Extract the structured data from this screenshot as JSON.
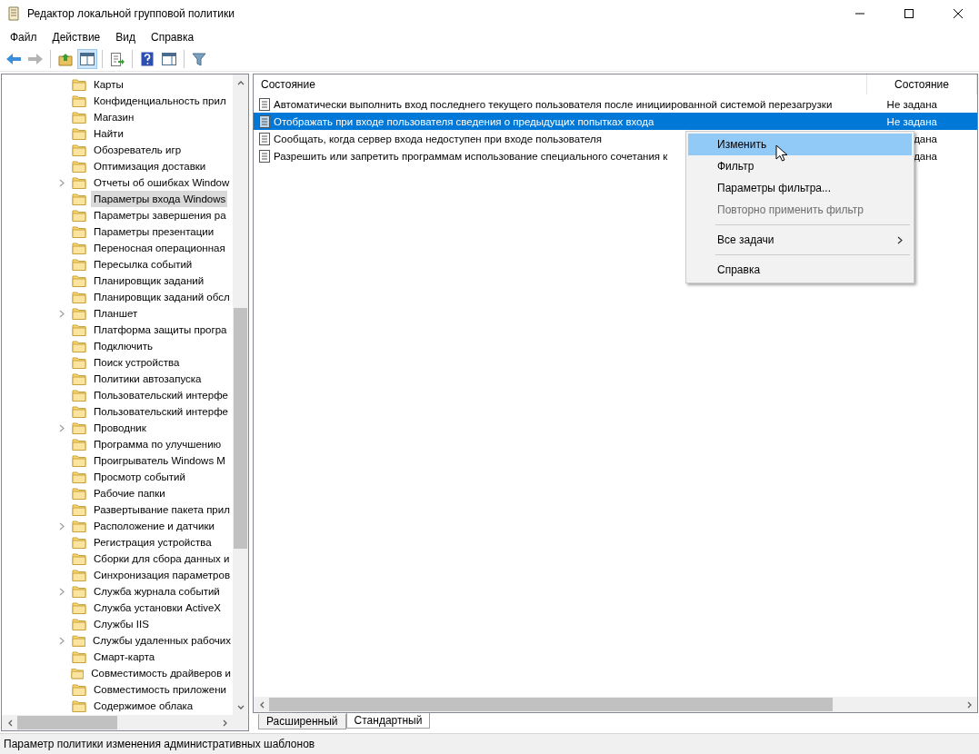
{
  "window": {
    "title": "Редактор локальной групповой политики"
  },
  "menu_bar": [
    "Файл",
    "Действие",
    "Вид",
    "Справка"
  ],
  "toolbar": [
    {
      "kind": "back",
      "pressed": false,
      "disabled": false
    },
    {
      "kind": "forward",
      "pressed": false,
      "disabled": true
    },
    {
      "kind": "sep"
    },
    {
      "kind": "up",
      "pressed": false,
      "disabled": false
    },
    {
      "kind": "tree",
      "pressed": true,
      "disabled": false
    },
    {
      "kind": "sep"
    },
    {
      "kind": "export",
      "pressed": false,
      "disabled": false
    },
    {
      "kind": "sep"
    },
    {
      "kind": "help",
      "pressed": false,
      "disabled": false
    },
    {
      "kind": "pane",
      "pressed": false,
      "disabled": false
    },
    {
      "kind": "sep"
    },
    {
      "kind": "filter",
      "pressed": false,
      "disabled": false
    }
  ],
  "tree": [
    {
      "label": "Карты",
      "expandable": false,
      "selected": false
    },
    {
      "label": "Конфиденциальность прил",
      "expandable": false,
      "selected": false
    },
    {
      "label": "Магазин",
      "expandable": false,
      "selected": false
    },
    {
      "label": "Найти",
      "expandable": false,
      "selected": false
    },
    {
      "label": "Обозреватель игр",
      "expandable": false,
      "selected": false
    },
    {
      "label": "Оптимизация доставки",
      "expandable": false,
      "selected": false
    },
    {
      "label": "Отчеты об ошибках Window",
      "expandable": true,
      "selected": false
    },
    {
      "label": "Параметры входа Windows",
      "expandable": false,
      "selected": true
    },
    {
      "label": "Параметры завершения ра",
      "expandable": false,
      "selected": false
    },
    {
      "label": "Параметры презентации",
      "expandable": false,
      "selected": false
    },
    {
      "label": "Переносная операционная",
      "expandable": false,
      "selected": false
    },
    {
      "label": "Пересылка событий",
      "expandable": false,
      "selected": false
    },
    {
      "label": "Планировщик заданий",
      "expandable": false,
      "selected": false
    },
    {
      "label": "Планировщик заданий обсл",
      "expandable": false,
      "selected": false
    },
    {
      "label": "Планшет",
      "expandable": true,
      "selected": false
    },
    {
      "label": "Платформа защиты програ",
      "expandable": false,
      "selected": false
    },
    {
      "label": "Подключить",
      "expandable": false,
      "selected": false
    },
    {
      "label": "Поиск устройства",
      "expandable": false,
      "selected": false
    },
    {
      "label": "Политики автозапуска",
      "expandable": false,
      "selected": false
    },
    {
      "label": "Пользовательский интерфе",
      "expandable": false,
      "selected": false
    },
    {
      "label": "Пользовательский интерфе",
      "expandable": false,
      "selected": false
    },
    {
      "label": "Проводник",
      "expandable": true,
      "selected": false
    },
    {
      "label": "Программа по улучшению",
      "expandable": false,
      "selected": false
    },
    {
      "label": "Проигрыватель Windows M",
      "expandable": false,
      "selected": false
    },
    {
      "label": "Просмотр событий",
      "expandable": false,
      "selected": false
    },
    {
      "label": "Рабочие папки",
      "expandable": false,
      "selected": false
    },
    {
      "label": "Развертывание пакета прил",
      "expandable": false,
      "selected": false
    },
    {
      "label": "Расположение и датчики",
      "expandable": true,
      "selected": false
    },
    {
      "label": "Регистрация устройства",
      "expandable": false,
      "selected": false
    },
    {
      "label": "Сборки для сбора данных и",
      "expandable": false,
      "selected": false
    },
    {
      "label": "Синхронизация параметров",
      "expandable": false,
      "selected": false
    },
    {
      "label": "Служба журнала событий",
      "expandable": true,
      "selected": false
    },
    {
      "label": "Служба установки ActiveX",
      "expandable": false,
      "selected": false
    },
    {
      "label": "Службы IIS",
      "expandable": false,
      "selected": false
    },
    {
      "label": "Службы удаленных рабочих",
      "expandable": true,
      "selected": false
    },
    {
      "label": "Смарт-карта",
      "expandable": false,
      "selected": false
    },
    {
      "label": "Совместимость драйверов и",
      "expandable": false,
      "selected": false
    },
    {
      "label": "Совместимость приложени",
      "expandable": false,
      "selected": false
    },
    {
      "label": "Содержимое облака",
      "expandable": false,
      "selected": false
    }
  ],
  "table": {
    "columns": [
      "Состояние",
      "Состояние"
    ],
    "rows": [
      {
        "name": "Автоматически выполнить вход последнего текущего пользователя после инициированной системой перезагрузки",
        "state": "Не задана",
        "selected": false
      },
      {
        "name": "Отображать при входе пользователя сведения о предыдущих попытках входа",
        "state": "Не задана",
        "selected": true
      },
      {
        "name": "Сообщать, когда сервер входа недоступен при входе пользователя",
        "state": "дана",
        "selected": false
      },
      {
        "name": "Разрешить или запретить программам использование специального сочетания к",
        "state": "дана",
        "selected": false
      }
    ]
  },
  "context_menu": [
    {
      "kind": "item",
      "label": "Изменить",
      "selected": true,
      "disabled": false
    },
    {
      "kind": "item",
      "label": "Фильтр",
      "selected": false,
      "disabled": false
    },
    {
      "kind": "item",
      "label": "Параметры фильтра...",
      "selected": false,
      "disabled": false
    },
    {
      "kind": "item",
      "label": "Повторно применить фильтр",
      "selected": false,
      "disabled": true
    },
    {
      "kind": "separator"
    },
    {
      "kind": "submenu",
      "label": "Все задачи",
      "selected": false,
      "disabled": false
    },
    {
      "kind": "separator"
    },
    {
      "kind": "item",
      "label": "Справка",
      "selected": false,
      "disabled": false
    }
  ],
  "view_tabs": [
    {
      "label": "Расширенный",
      "selected": false
    },
    {
      "label": "Стандартный",
      "selected": true
    }
  ],
  "status_bar": "Параметр политики изменения административных шаблонов"
}
